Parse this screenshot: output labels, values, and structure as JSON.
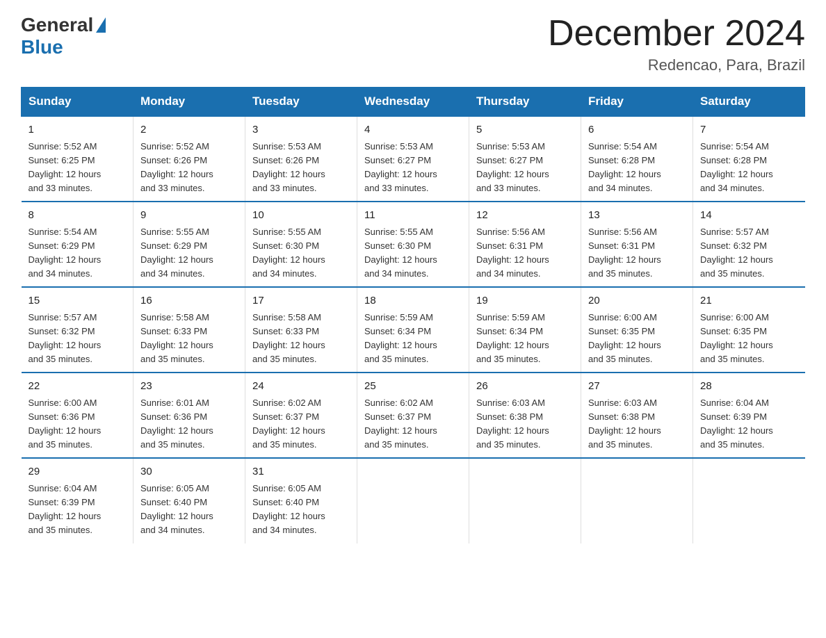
{
  "header": {
    "logo_general": "General",
    "logo_blue": "Blue",
    "month_year": "December 2024",
    "location": "Redencao, Para, Brazil"
  },
  "days_of_week": [
    "Sunday",
    "Monday",
    "Tuesday",
    "Wednesday",
    "Thursday",
    "Friday",
    "Saturday"
  ],
  "weeks": [
    [
      {
        "day": "1",
        "sunrise": "5:52 AM",
        "sunset": "6:25 PM",
        "daylight": "12 hours and 33 minutes."
      },
      {
        "day": "2",
        "sunrise": "5:52 AM",
        "sunset": "6:26 PM",
        "daylight": "12 hours and 33 minutes."
      },
      {
        "day": "3",
        "sunrise": "5:53 AM",
        "sunset": "6:26 PM",
        "daylight": "12 hours and 33 minutes."
      },
      {
        "day": "4",
        "sunrise": "5:53 AM",
        "sunset": "6:27 PM",
        "daylight": "12 hours and 33 minutes."
      },
      {
        "day": "5",
        "sunrise": "5:53 AM",
        "sunset": "6:27 PM",
        "daylight": "12 hours and 33 minutes."
      },
      {
        "day": "6",
        "sunrise": "5:54 AM",
        "sunset": "6:28 PM",
        "daylight": "12 hours and 34 minutes."
      },
      {
        "day": "7",
        "sunrise": "5:54 AM",
        "sunset": "6:28 PM",
        "daylight": "12 hours and 34 minutes."
      }
    ],
    [
      {
        "day": "8",
        "sunrise": "5:54 AM",
        "sunset": "6:29 PM",
        "daylight": "12 hours and 34 minutes."
      },
      {
        "day": "9",
        "sunrise": "5:55 AM",
        "sunset": "6:29 PM",
        "daylight": "12 hours and 34 minutes."
      },
      {
        "day": "10",
        "sunrise": "5:55 AM",
        "sunset": "6:30 PM",
        "daylight": "12 hours and 34 minutes."
      },
      {
        "day": "11",
        "sunrise": "5:55 AM",
        "sunset": "6:30 PM",
        "daylight": "12 hours and 34 minutes."
      },
      {
        "day": "12",
        "sunrise": "5:56 AM",
        "sunset": "6:31 PM",
        "daylight": "12 hours and 34 minutes."
      },
      {
        "day": "13",
        "sunrise": "5:56 AM",
        "sunset": "6:31 PM",
        "daylight": "12 hours and 35 minutes."
      },
      {
        "day": "14",
        "sunrise": "5:57 AM",
        "sunset": "6:32 PM",
        "daylight": "12 hours and 35 minutes."
      }
    ],
    [
      {
        "day": "15",
        "sunrise": "5:57 AM",
        "sunset": "6:32 PM",
        "daylight": "12 hours and 35 minutes."
      },
      {
        "day": "16",
        "sunrise": "5:58 AM",
        "sunset": "6:33 PM",
        "daylight": "12 hours and 35 minutes."
      },
      {
        "day": "17",
        "sunrise": "5:58 AM",
        "sunset": "6:33 PM",
        "daylight": "12 hours and 35 minutes."
      },
      {
        "day": "18",
        "sunrise": "5:59 AM",
        "sunset": "6:34 PM",
        "daylight": "12 hours and 35 minutes."
      },
      {
        "day": "19",
        "sunrise": "5:59 AM",
        "sunset": "6:34 PM",
        "daylight": "12 hours and 35 minutes."
      },
      {
        "day": "20",
        "sunrise": "6:00 AM",
        "sunset": "6:35 PM",
        "daylight": "12 hours and 35 minutes."
      },
      {
        "day": "21",
        "sunrise": "6:00 AM",
        "sunset": "6:35 PM",
        "daylight": "12 hours and 35 minutes."
      }
    ],
    [
      {
        "day": "22",
        "sunrise": "6:00 AM",
        "sunset": "6:36 PM",
        "daylight": "12 hours and 35 minutes."
      },
      {
        "day": "23",
        "sunrise": "6:01 AM",
        "sunset": "6:36 PM",
        "daylight": "12 hours and 35 minutes."
      },
      {
        "day": "24",
        "sunrise": "6:02 AM",
        "sunset": "6:37 PM",
        "daylight": "12 hours and 35 minutes."
      },
      {
        "day": "25",
        "sunrise": "6:02 AM",
        "sunset": "6:37 PM",
        "daylight": "12 hours and 35 minutes."
      },
      {
        "day": "26",
        "sunrise": "6:03 AM",
        "sunset": "6:38 PM",
        "daylight": "12 hours and 35 minutes."
      },
      {
        "day": "27",
        "sunrise": "6:03 AM",
        "sunset": "6:38 PM",
        "daylight": "12 hours and 35 minutes."
      },
      {
        "day": "28",
        "sunrise": "6:04 AM",
        "sunset": "6:39 PM",
        "daylight": "12 hours and 35 minutes."
      }
    ],
    [
      {
        "day": "29",
        "sunrise": "6:04 AM",
        "sunset": "6:39 PM",
        "daylight": "12 hours and 35 minutes."
      },
      {
        "day": "30",
        "sunrise": "6:05 AM",
        "sunset": "6:40 PM",
        "daylight": "12 hours and 34 minutes."
      },
      {
        "day": "31",
        "sunrise": "6:05 AM",
        "sunset": "6:40 PM",
        "daylight": "12 hours and 34 minutes."
      },
      null,
      null,
      null,
      null
    ]
  ],
  "labels": {
    "sunrise_prefix": "Sunrise: ",
    "sunset_prefix": "Sunset: ",
    "daylight_prefix": "Daylight: "
  }
}
